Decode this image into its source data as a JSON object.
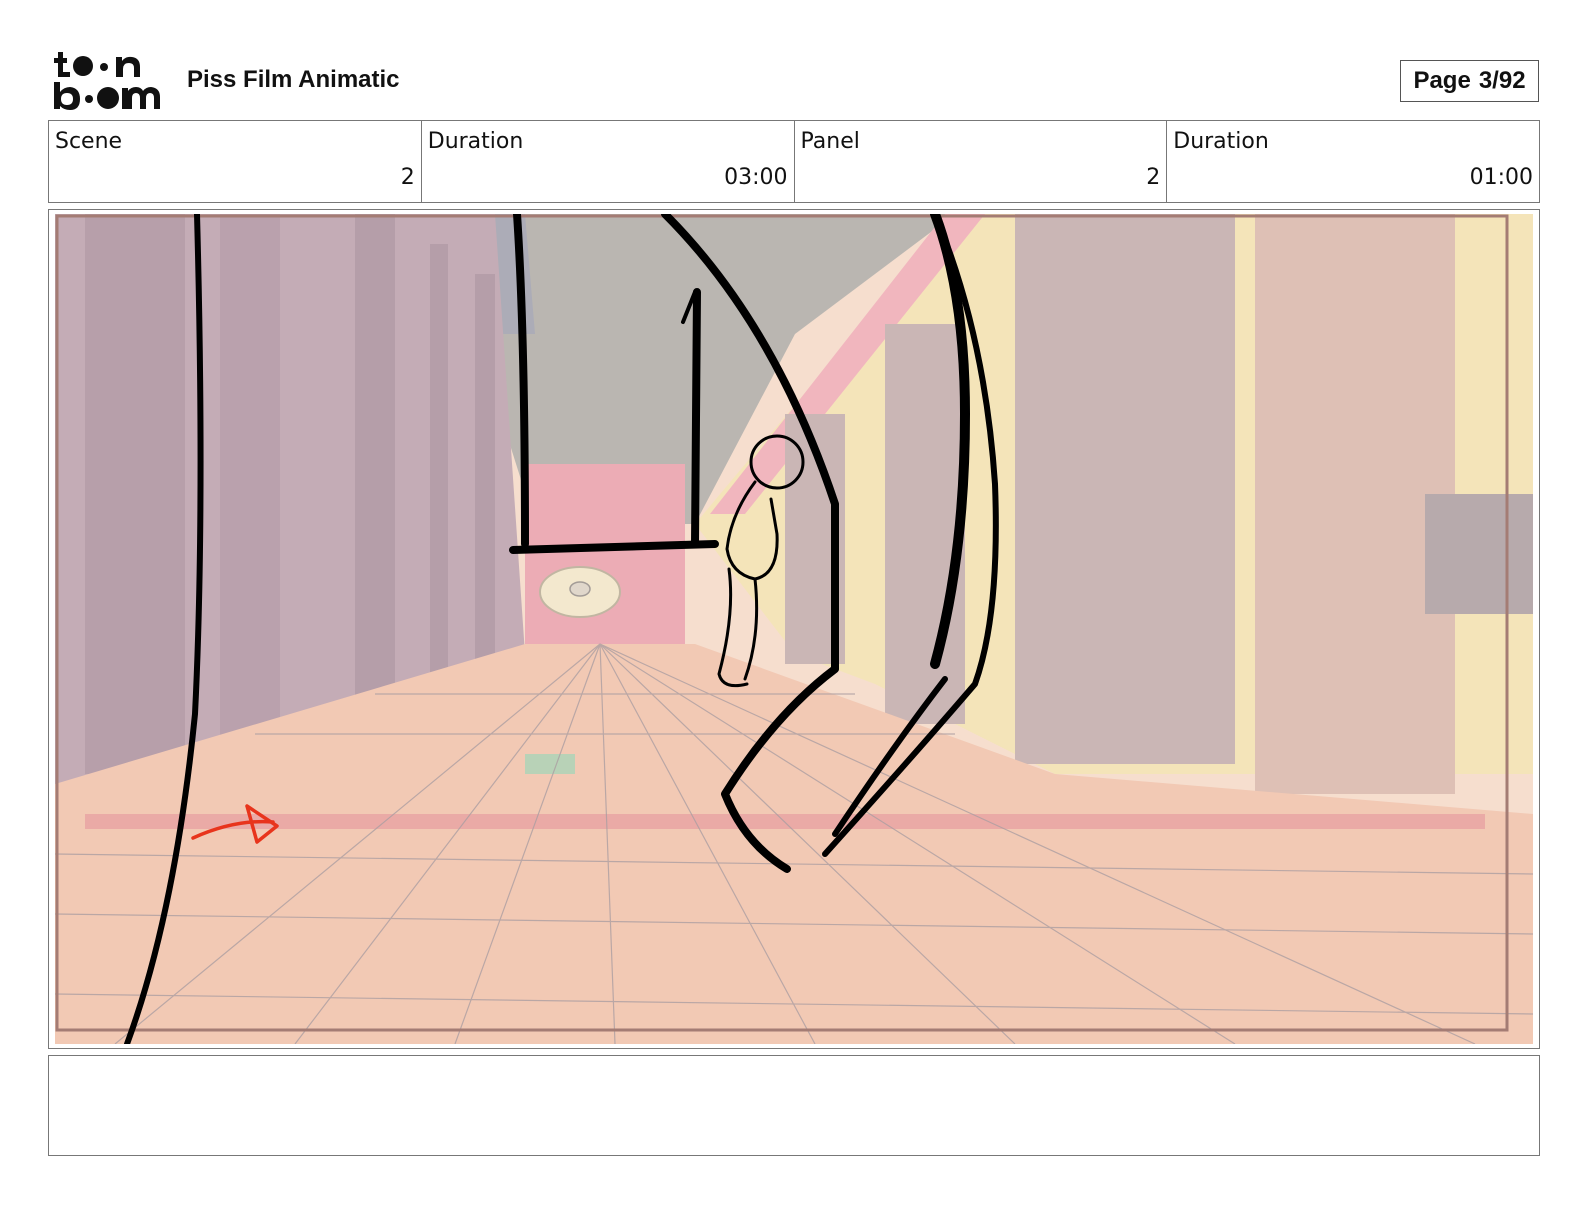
{
  "header": {
    "logo_text": "toon boom",
    "title": "Piss Film Animatic",
    "page_label": "Page",
    "page_value": "3/92"
  },
  "info": {
    "scene_label": "Scene",
    "scene_value": "2",
    "scene_duration_label": "Duration",
    "scene_duration_value": "03:00",
    "panel_label": "Panel",
    "panel_value": "2",
    "panel_duration_label": "Duration",
    "panel_duration_value": "01:00"
  },
  "caption": {
    "text": ""
  },
  "colors": {
    "sketch_line": "#000000",
    "arrow": "#e8341c",
    "floor_base": "#f2c2a6",
    "wall_mauve": "#b99aa5",
    "back_wall_pink": "#e99aa6",
    "ceiling": "#a9a29c"
  }
}
